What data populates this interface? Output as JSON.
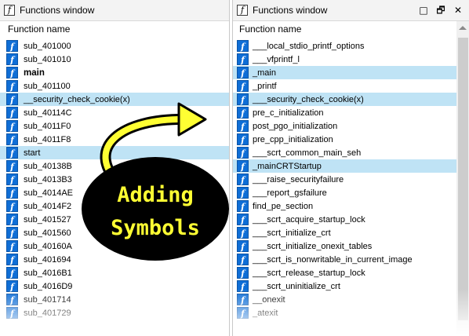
{
  "left_window": {
    "title": "Functions window",
    "header": "Function name",
    "items": [
      {
        "name": "sub_401000",
        "selected": false,
        "bold": false
      },
      {
        "name": "sub_401010",
        "selected": false,
        "bold": false
      },
      {
        "name": "main",
        "selected": false,
        "bold": true
      },
      {
        "name": "sub_401100",
        "selected": false,
        "bold": false
      },
      {
        "name": "__security_check_cookie(x)",
        "selected": true,
        "bold": false
      },
      {
        "name": "sub_40114C",
        "selected": false,
        "bold": false
      },
      {
        "name": "sub_4011F0",
        "selected": false,
        "bold": false
      },
      {
        "name": "sub_4011F8",
        "selected": false,
        "bold": false
      },
      {
        "name": "start",
        "selected": true,
        "bold": false
      },
      {
        "name": "sub_40138B",
        "selected": false,
        "bold": false
      },
      {
        "name": "sub_4013B3",
        "selected": false,
        "bold": false
      },
      {
        "name": "sub_4014AE",
        "selected": false,
        "bold": false
      },
      {
        "name": "sub_4014F2",
        "selected": false,
        "bold": false
      },
      {
        "name": "sub_401527",
        "selected": false,
        "bold": false
      },
      {
        "name": "sub_401560",
        "selected": false,
        "bold": false
      },
      {
        "name": "sub_40160A",
        "selected": false,
        "bold": false
      },
      {
        "name": "sub_401694",
        "selected": false,
        "bold": false
      },
      {
        "name": "sub_4016B1",
        "selected": false,
        "bold": false
      },
      {
        "name": "sub_4016D9",
        "selected": false,
        "bold": false
      },
      {
        "name": "sub_401714",
        "selected": false,
        "bold": false
      },
      {
        "name": "sub_401729",
        "selected": false,
        "bold": false
      }
    ]
  },
  "right_window": {
    "title": "Functions window",
    "header": "Function name",
    "controls": {
      "close": "□",
      "restore": "🗗",
      "close_x": "✕"
    },
    "items": [
      {
        "name": "___local_stdio_printf_options",
        "selected": false
      },
      {
        "name": "___vfprintf_l",
        "selected": false
      },
      {
        "name": "_main",
        "selected": true
      },
      {
        "name": "_printf",
        "selected": false
      },
      {
        "name": "___security_check_cookie(x)",
        "selected": true
      },
      {
        "name": "pre_c_initialization",
        "selected": false
      },
      {
        "name": "post_pgo_initialization",
        "selected": false
      },
      {
        "name": "pre_cpp_initialization",
        "selected": false
      },
      {
        "name": "___scrt_common_main_seh",
        "selected": false
      },
      {
        "name": "_mainCRTStartup",
        "selected": true
      },
      {
        "name": "___raise_securityfailure",
        "selected": false
      },
      {
        "name": "___report_gsfailure",
        "selected": false
      },
      {
        "name": "find_pe_section",
        "selected": false
      },
      {
        "name": "___scrt_acquire_startup_lock",
        "selected": false
      },
      {
        "name": "___scrt_initialize_crt",
        "selected": false
      },
      {
        "name": "___scrt_initialize_onexit_tables",
        "selected": false
      },
      {
        "name": "___scrt_is_nonwritable_in_current_image",
        "selected": false
      },
      {
        "name": "___scrt_release_startup_lock",
        "selected": false
      },
      {
        "name": "___scrt_uninitialize_crt",
        "selected": false
      },
      {
        "name": "__onexit",
        "selected": false
      },
      {
        "name": "_atexit",
        "selected": false
      }
    ]
  },
  "badge": {
    "line1": "Adding",
    "line2": "Symbols"
  },
  "colors": {
    "selection": "#bfe3f5",
    "function_icon": "#0f6ed6",
    "badge_text": "#ffff33"
  },
  "icons": {
    "function": "function-icon",
    "window": "functions-window-icon"
  }
}
